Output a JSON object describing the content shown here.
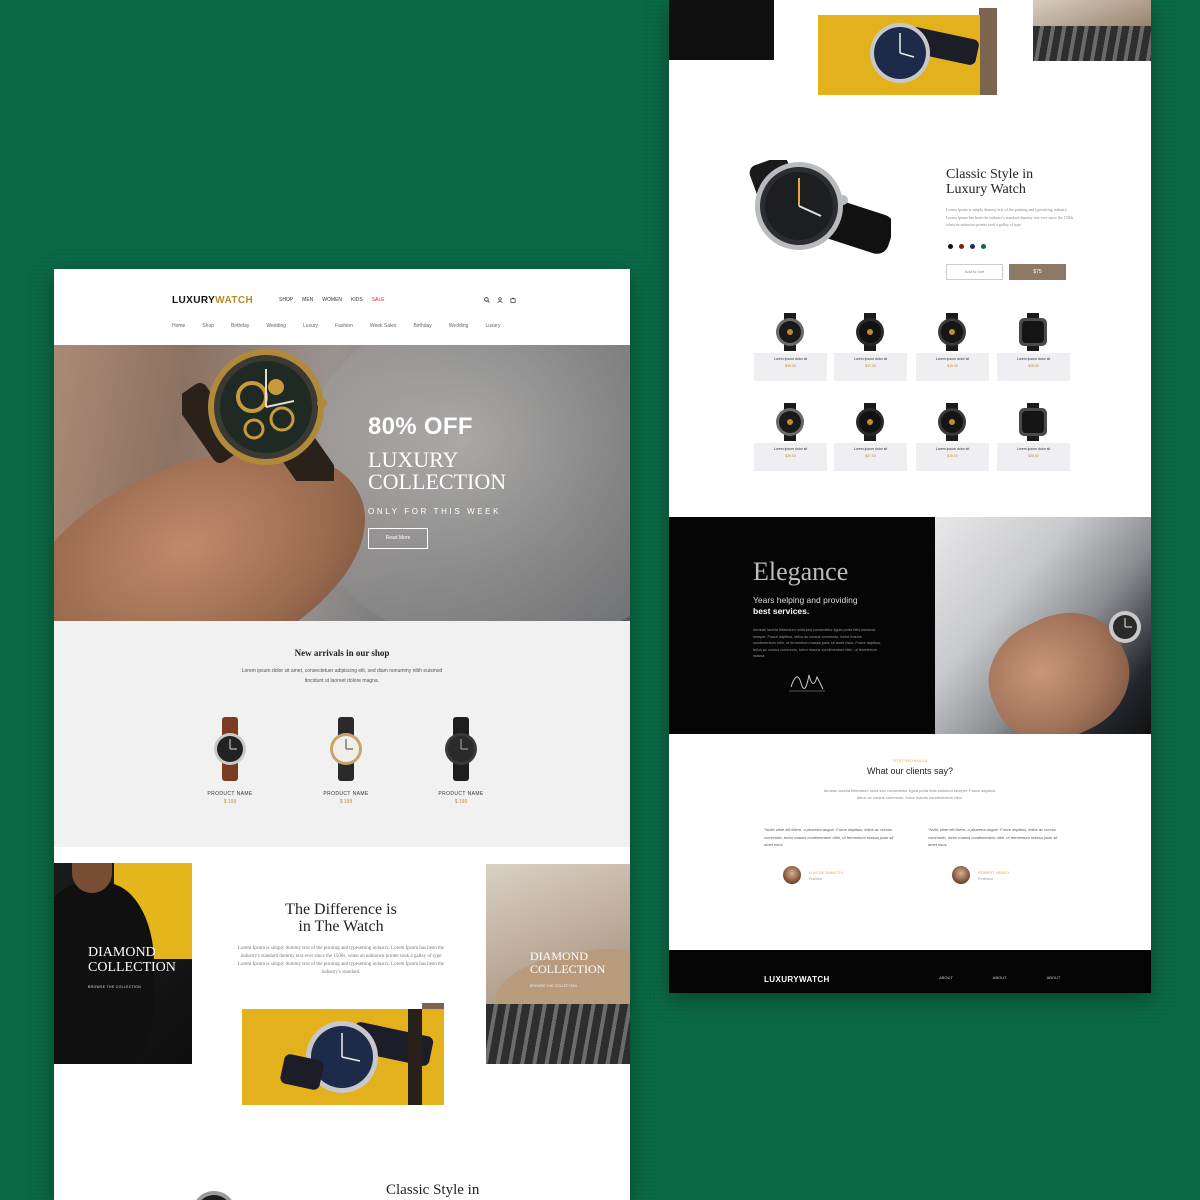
{
  "left": {
    "logo_a": "LUXURY",
    "logo_b": "WATCH",
    "topnav": [
      "SHOP",
      "MEN",
      "WOMEN",
      "KIDS",
      "SALE"
    ],
    "subnav": [
      "Home",
      "Shop",
      "Birthday",
      "Wedding",
      "Luxury",
      "Fashion",
      "Week Sales",
      "Birthday",
      "Wedding",
      "Luxury"
    ],
    "hero": {
      "off": "80% OFF",
      "title_1": "LUXURY",
      "title_2": "COLLECTION",
      "sub": "ONLY FOR THIS WEEK",
      "button": "Read More"
    },
    "arrivals": {
      "title": "New arrivals in our shop",
      "desc": "Lorem ipsum dolor sit amet, consectetuer adipiscing elit, sed diam nonummy nibh euismod tincidunt ut laoreet dolore magna.",
      "products": [
        {
          "name": "PRODUCT NAME",
          "price": "$ 199"
        },
        {
          "name": "PRODUCT NAME",
          "price": "$ 199"
        },
        {
          "name": "PRODUCT NAME",
          "price": "$ 199"
        }
      ]
    },
    "diamond_left": {
      "title_1": "DIAMOND",
      "title_2": "COLLECTION",
      "sub": "BROWSE THE COLLECTION"
    },
    "difference": {
      "title_1": "The Difference is",
      "title_2": "in The Watch",
      "desc": "Lorem Ipsum is simply dummy text of the printing and typesetting industry. Lorem Ipsum has been the industry's standard dummy text ever since the 1500s, when an unknown printer took a galley of type Lorem Ipsum is simply dummy text of the printing and typesetting industry. Lorem Ipsum has been the industry's standard."
    },
    "diamond_right": {
      "title_1": "DIAMOND",
      "title_2": "COLLECTION",
      "sub": "BROWSE THE COLLECTION"
    },
    "classic_peek": "Classic Style in"
  },
  "right": {
    "classic": {
      "title_1": "Classic Style in",
      "title_2": "Luxury Watch",
      "desc": "Lorem Ipsum is simply dummy text of the printing and typesetting industry. Lorem Ipsum has been the industry's standard dummy text ever since the 1500s, when an unknown printer took a galley of type.",
      "add_to_cart": "Add to cart",
      "price": "$75",
      "swatch_colors": [
        "#111111",
        "#7a1e1e",
        "#1e2a6e",
        "#1f5e3a"
      ]
    },
    "grid": [
      {
        "name": "Lorem ipsum dolor sit",
        "price": "$39.00"
      },
      {
        "name": "Lorem ipsum dolor sit",
        "price": "$37.00"
      },
      {
        "name": "Lorem ipsum dolor sit",
        "price": "$15.00"
      },
      {
        "name": "Lorem ipsum dolor sit",
        "price": "$25.00"
      },
      {
        "name": "Lorem ipsum dolor sit",
        "price": "$39.00"
      },
      {
        "name": "Lorem ipsum dolor sit",
        "price": "$37.00"
      },
      {
        "name": "Lorem ipsum dolor sit",
        "price": "$15.00"
      },
      {
        "name": "Lorem ipsum dolor sit",
        "price": "$25.00"
      }
    ],
    "elegance": {
      "title": "Elegance",
      "sub_1": "Years helping and providing",
      "sub_2": "best services.",
      "desc": "Aenean lacinia bibendum nulla sed consectetur ligula porta felis euismod semper. Fusce dapibus, tellus ac cursus commodo, tortor mauris condimentum nibh, ut fermentum massa justo sit amet risus. Fusce dapibus, tellus ac cursus commodo, tortor mauris condimentum nibh, ut fermentum massa."
    },
    "testimonials": {
      "label": "TESTIMONIALS",
      "title": "What our clients say?",
      "desc": "Aenean lacinia bibendum nulla sed consectetur ligula porta felis euismod semper. Fusce dapibus, tellus ac cursus commodo, tortor mauris condimentum nibh.",
      "quotes": [
        {
          "text": "\"Nulla vitae elit libero, a pharetra augue. Fusce dapibus, tellus ac cursus commodo, tortor mauris condimentum nibh, ut fermentum massa justo sit amet risus.",
          "name": "LUIS DE SANCTIS",
          "role": "Publicist"
        },
        {
          "text": "\"Nulla vitae elit libero, a pharetra augue. Fusce dapibus, tellus ac cursus commodo, tortor mauris condimentum nibh, ut fermentum massa justo sit amet risus.",
          "name": "ROBERT HENDY",
          "role": "Professor"
        }
      ]
    },
    "footer": {
      "logo": "LUXURYWATCH",
      "links": [
        "ABOUT",
        "ABOUT",
        "ABOUT"
      ]
    }
  },
  "colors": {
    "background": "#0b6a46",
    "accent_gold": "#b98a2c",
    "sale_red": "#d6332a",
    "yellow_panel": "#e3b11b",
    "price_button": "#8d7a66"
  },
  "icons": [
    "search-icon",
    "user-icon",
    "cart-icon"
  ]
}
